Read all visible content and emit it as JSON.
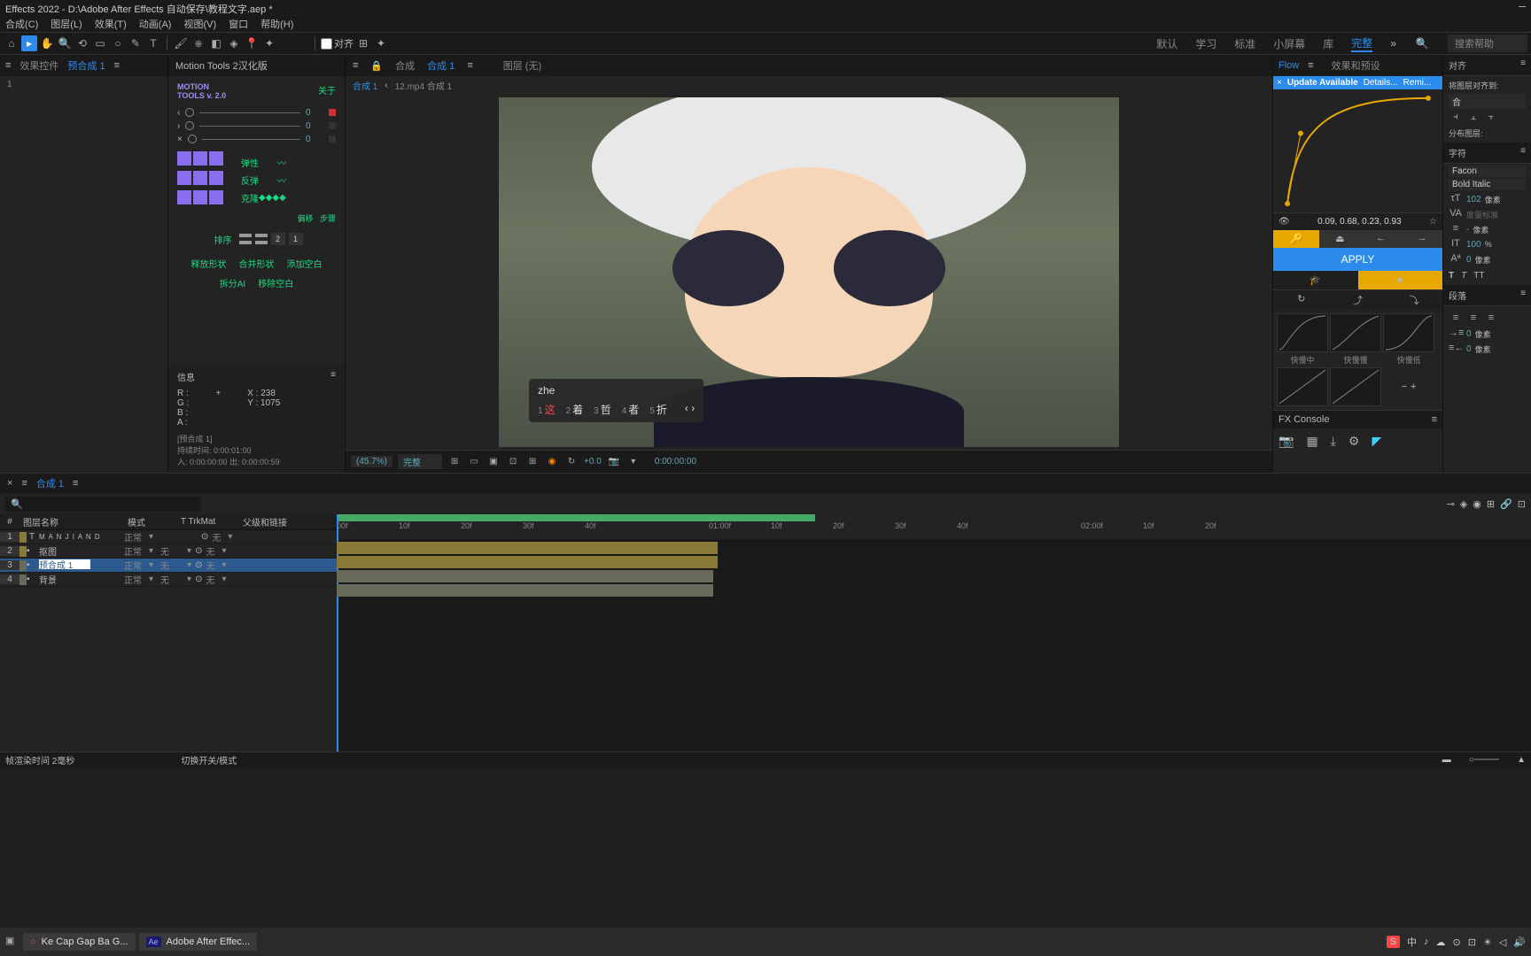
{
  "title": "Effects 2022 - D:\\Adobe After Effects 自动保存\\教程文字.aep *",
  "menu": [
    "合成(C)",
    "图层(L)",
    "效果(T)",
    "动画(A)",
    "视图(V)",
    "窗口",
    "帮助(H)"
  ],
  "toolbar": {
    "align": "对齐"
  },
  "workspaces": [
    "默认",
    "学习",
    "标准",
    "小屏幕",
    "库",
    "完整"
  ],
  "workspace_active": "完整",
  "search_help": "搜索帮助",
  "left_panel": {
    "tab1": "效果控件",
    "tab2": "预合成 1"
  },
  "motion": {
    "title": "Motion Tools 2汉化版",
    "brand": "MOTION\nTOOLS v. 2.0",
    "about": "关于",
    "sliders": [
      0,
      0,
      0
    ],
    "props": {
      "elastic": "弹性",
      "bounce": "反弹",
      "clone": "克隆"
    },
    "offset": "偏移",
    "step": "步骤",
    "sort": "排序",
    "sortvals": [
      2,
      1
    ],
    "btns": {
      "release": "释放形状",
      "merge": "合并形状",
      "addnull": "添加空白",
      "breakai": "拆分AI",
      "removenull": "移除空白"
    }
  },
  "info": {
    "title": "信息",
    "R": "R :",
    "G": "G :",
    "B": "B :",
    "A": "A :",
    "X": "X : 238",
    "Y": "Y : 1075",
    "precomp": "[预合成 1]",
    "dur": "持续时间: 0:00:01:00",
    "inout": "入: 0:00:00:00  出: 0:00:00:59"
  },
  "comp": {
    "tab1": "合成",
    "tab2": "合成 1",
    "tab3": "图层  (无)",
    "crumb1": "合成 1",
    "crumb2": "12.mp4 合成 1"
  },
  "ime": {
    "input": "zhe",
    "cands": [
      {
        "n": "1",
        "t": "这"
      },
      {
        "n": "2",
        "t": "着"
      },
      {
        "n": "3",
        "t": "哲"
      },
      {
        "n": "4",
        "t": "者"
      },
      {
        "n": "5",
        "t": "折"
      }
    ]
  },
  "viewer": {
    "zoom": "(45.7%)",
    "res": "完整",
    "offset": "+0.0",
    "time": "0:00:00:00"
  },
  "flow": {
    "tabs": [
      "Flow",
      "效果和预设"
    ],
    "notice": {
      "avail": "Update Available",
      "details": "Details...",
      "remind": "Remi..."
    },
    "values": "0.09, 0.68, 0.23, 0.93",
    "apply": "APPLY",
    "presets": [
      "快慢中",
      "快慢慢",
      "快慢低"
    ]
  },
  "fxconsole": "FX Console",
  "align": {
    "title": "对齐",
    "layers": "将图层对齐到:",
    "dist": "分布图层:"
  },
  "char": {
    "title": "字符",
    "font": "Facon",
    "style": "Bold Italic",
    "size": "102",
    "unit": "像素",
    "track": "度量标准",
    "kern": "-",
    "px": "像素",
    "vscale": "100",
    "pct": "%",
    "baseline": "0",
    "px2": "像素"
  },
  "para": {
    "title": "段落"
  },
  "timeline": {
    "tab": "合成 1",
    "search": "",
    "hdr": {
      "num": "#",
      "name": "图层名称",
      "mode": "模式",
      "trk": "T   TrkMat",
      "parent": "父级和链接"
    },
    "layers": [
      {
        "n": "1",
        "name": "M A N J I A N D",
        "mode": "正常",
        "trk": "",
        "par": "无",
        "color": "#8a7a3a"
      },
      {
        "n": "2",
        "name": "抠图",
        "mode": "正常",
        "trk": "无",
        "par": "无",
        "color": "#8a7a3a"
      },
      {
        "n": "3",
        "name": "预合成 1",
        "mode": "正常",
        "trk": "无",
        "par": "无",
        "color": "#6a6a5a",
        "sel": true
      },
      {
        "n": "4",
        "name": "背景",
        "mode": "正常",
        "trk": "无",
        "par": "无",
        "color": "#6a6a5a"
      }
    ],
    "ticks": [
      "00f",
      "10f",
      "20f",
      "30f",
      "40f",
      "01:00f",
      "10f",
      "20f",
      "30f",
      "40f",
      "02:00f",
      "10f",
      "20f"
    ],
    "render": "帧渲染时间  2毫秒",
    "toggle": "切换开关/模式"
  },
  "taskbar": {
    "items": [
      {
        "icon": "○",
        "label": "Ke Cap Gap Ba G..."
      },
      {
        "icon": "Ae",
        "label": "Adobe After Effec..."
      }
    ],
    "tray": [
      "S",
      "中",
      "♪",
      "☁",
      "⊙",
      "⊡",
      "☀",
      "◁",
      "🔊"
    ]
  }
}
